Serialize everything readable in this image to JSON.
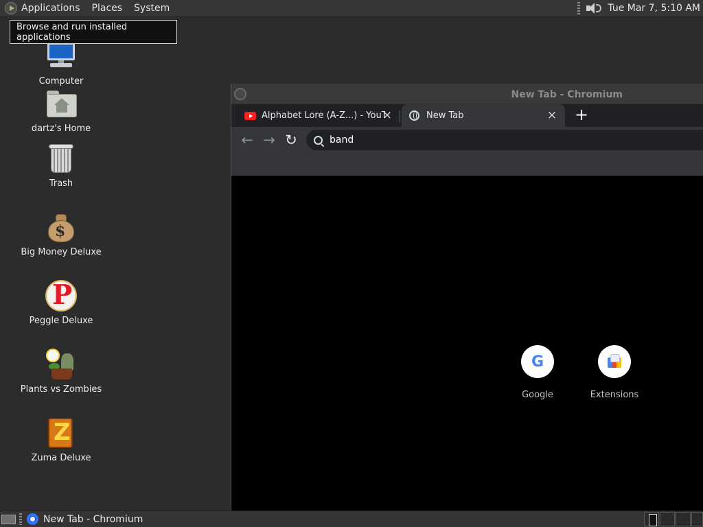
{
  "top_panel": {
    "menus": [
      "Applications",
      "Places",
      "System"
    ],
    "clock": "Tue Mar  7,  5:10 AM"
  },
  "tooltip": {
    "text": "Browse and run installed applications"
  },
  "desktop": {
    "items": [
      {
        "label": "Computer",
        "icon": "computer-icon"
      },
      {
        "label": "dartz's Home",
        "icon": "home-folder-icon"
      },
      {
        "label": "Trash",
        "icon": "trash-icon"
      },
      {
        "label": "Big Money Deluxe",
        "icon": "money-bag-icon"
      },
      {
        "label": "Peggle Deluxe",
        "icon": "peggle-icon"
      },
      {
        "label": "Plants vs Zombies",
        "icon": "plants-vs-zombies-icon"
      },
      {
        "label": "Zuma Deluxe",
        "icon": "zuma-icon"
      }
    ]
  },
  "browser": {
    "window_title": "New Tab - Chromium",
    "tabs": [
      {
        "title": "Alphabet Lore (A-Z...) - YouTube",
        "favicon": "youtube-icon",
        "active": false
      },
      {
        "title": "New Tab",
        "favicon": "globe-icon",
        "active": true
      }
    ],
    "new_tab_symbol": "+",
    "close_symbol": "×",
    "back_symbol": "←",
    "forward_symbol": "→",
    "reload_symbol": "↻",
    "omnibox": {
      "value": "band"
    },
    "shortcuts": [
      {
        "label": "Google",
        "icon": "google-icon",
        "glyph": "G"
      },
      {
        "label": "Extensions",
        "icon": "extensions-icon"
      }
    ]
  },
  "taskbar": {
    "window_button_label": "New Tab - Chromium"
  },
  "colors": {
    "desktop_background": "#2b2c2b",
    "browser_tabstrip": "#202124",
    "browser_toolbar": "#35363a",
    "new_tab_page": "#000000",
    "google_blue": "#4285f4"
  }
}
